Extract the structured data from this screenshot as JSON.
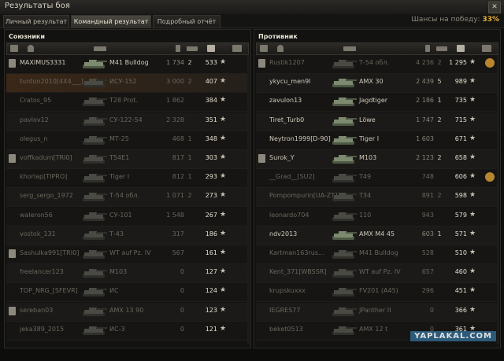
{
  "window": {
    "title": "Результаты боя",
    "close_label": "✕"
  },
  "tabs": [
    {
      "label": "Личный результат",
      "active": false
    },
    {
      "label": "Командный результат",
      "active": true
    },
    {
      "label": "Подробный отчёт",
      "active": false
    }
  ],
  "win_chance": {
    "label": "Шансы на победу:",
    "value": "33%"
  },
  "allies": {
    "title": "Союзники",
    "rows": [
      {
        "platoon": true,
        "name": "MAXIMUS3331",
        "vehicle": "M41 Bulldog",
        "damage": "1 734",
        "frags": "2",
        "xp": "533",
        "alive": true,
        "me": false,
        "medal": false
      },
      {
        "platoon": false,
        "name": "tuntun2010[4X4___]",
        "vehicle": "ИСУ-152",
        "damage": "3 000",
        "frags": "2",
        "xp": "407",
        "alive": false,
        "me": true,
        "medal": false
      },
      {
        "platoon": false,
        "name": "Cratos_95",
        "vehicle": "T28 Prot.",
        "damage": "1 862",
        "frags": "",
        "xp": "384",
        "alive": false,
        "me": false,
        "medal": false
      },
      {
        "platoon": false,
        "name": "pavlov12",
        "vehicle": "СУ-122-54",
        "damage": "2 328",
        "frags": "",
        "xp": "351",
        "alive": false,
        "me": false,
        "medal": false
      },
      {
        "platoon": false,
        "name": "olegus_n",
        "vehicle": "МТ-25",
        "damage": "468",
        "frags": "1",
        "xp": "348",
        "alive": false,
        "me": false,
        "medal": false
      },
      {
        "platoon": true,
        "name": "voffkadum[TRI0]",
        "vehicle": "T54E1",
        "damage": "817",
        "frags": "1",
        "xp": "303",
        "alive": false,
        "me": false,
        "medal": false
      },
      {
        "platoon": false,
        "name": "khorlap[TIPRO]",
        "vehicle": "Tiger I",
        "damage": "812",
        "frags": "1",
        "xp": "293",
        "alive": false,
        "me": false,
        "medal": false
      },
      {
        "platoon": false,
        "name": "serg_sergo_1972",
        "vehicle": "Т-54 обл.",
        "damage": "1 071",
        "frags": "2",
        "xp": "273",
        "alive": false,
        "me": false,
        "medal": false
      },
      {
        "platoon": false,
        "name": "waleron56",
        "vehicle": "СУ-101",
        "damage": "1 548",
        "frags": "",
        "xp": "267",
        "alive": false,
        "me": false,
        "medal": false
      },
      {
        "platoon": false,
        "name": "vostok_131",
        "vehicle": "Т-43",
        "damage": "317",
        "frags": "",
        "xp": "186",
        "alive": false,
        "me": false,
        "medal": false
      },
      {
        "platoon": true,
        "name": "Sashulka991[TRI0]",
        "vehicle": "WT auf Pz. IV",
        "damage": "567",
        "frags": "",
        "xp": "161",
        "alive": false,
        "me": false,
        "medal": false
      },
      {
        "platoon": false,
        "name": "freelancer123",
        "vehicle": "M103",
        "damage": "0",
        "frags": "",
        "xp": "127",
        "alive": false,
        "me": false,
        "medal": false
      },
      {
        "platoon": false,
        "name": "TOP_NRG_[SFEVR]",
        "vehicle": "ИС",
        "damage": "0",
        "frags": "",
        "xp": "124",
        "alive": false,
        "me": false,
        "medal": false
      },
      {
        "platoon": true,
        "name": "sereban03",
        "vehicle": "AMX 13 90",
        "damage": "0",
        "frags": "",
        "xp": "123",
        "alive": false,
        "me": false,
        "medal": false
      },
      {
        "platoon": false,
        "name": "jeka389_2015",
        "vehicle": "ИС-3",
        "damage": "0",
        "frags": "",
        "xp": "121",
        "alive": false,
        "me": false,
        "medal": false
      }
    ]
  },
  "enemies": {
    "title": "Противник",
    "rows": [
      {
        "platoon": true,
        "name": "Rustik1207",
        "vehicle": "Т-54 обл.",
        "damage": "4 236",
        "frags": "2",
        "xp": "1 295",
        "alive": false,
        "me": false,
        "medal": true
      },
      {
        "platoon": false,
        "name": "ykycu_men9l",
        "vehicle": "AMX 30",
        "damage": "2 439",
        "frags": "5",
        "xp": "989",
        "alive": true,
        "me": false,
        "medal": false
      },
      {
        "platoon": false,
        "name": "zavulon13",
        "vehicle": "Jagdtiger",
        "damage": "2 186",
        "frags": "1",
        "xp": "735",
        "alive": true,
        "me": false,
        "medal": false
      },
      {
        "platoon": false,
        "name": "Tiret_Turb0",
        "vehicle": "Löwe",
        "damage": "1 747",
        "frags": "2",
        "xp": "715",
        "alive": true,
        "me": false,
        "medal": false
      },
      {
        "platoon": false,
        "name": "Neytron1999[D-90]",
        "vehicle": "Tiger I",
        "damage": "1 603",
        "frags": "",
        "xp": "671",
        "alive": true,
        "me": false,
        "medal": false
      },
      {
        "platoon": true,
        "name": "Surok_Y",
        "vehicle": "M103",
        "damage": "2 123",
        "frags": "2",
        "xp": "658",
        "alive": true,
        "me": false,
        "medal": false
      },
      {
        "platoon": false,
        "name": "__Grad__[SU2]",
        "vehicle": "T49",
        "damage": "748",
        "frags": "",
        "xp": "606",
        "alive": false,
        "me": false,
        "medal": true
      },
      {
        "platoon": false,
        "name": "Pompompurin[UA-ZT]",
        "vehicle": "T34",
        "damage": "891",
        "frags": "2",
        "xp": "598",
        "alive": false,
        "me": false,
        "medal": false
      },
      {
        "platoon": false,
        "name": "leonardo704",
        "vehicle": "110",
        "damage": "943",
        "frags": "",
        "xp": "579",
        "alive": false,
        "me": false,
        "medal": false
      },
      {
        "platoon": false,
        "name": "ndv2013",
        "vehicle": "AMX M4 45",
        "damage": "603",
        "frags": "1",
        "xp": "571",
        "alive": true,
        "me": false,
        "medal": false
      },
      {
        "platoon": false,
        "name": "Kartman163rus...",
        "vehicle": "M41 Bulldog",
        "damage": "528",
        "frags": "",
        "xp": "510",
        "alive": false,
        "me": false,
        "medal": false
      },
      {
        "platoon": false,
        "name": "Kent_371[WBSSR]",
        "vehicle": "WT auf Pz. IV",
        "damage": "657",
        "frags": "",
        "xp": "460",
        "alive": false,
        "me": false,
        "medal": false
      },
      {
        "platoon": false,
        "name": "krupskuxxx",
        "vehicle": "FV201 (A45)",
        "damage": "296",
        "frags": "",
        "xp": "451",
        "alive": false,
        "me": false,
        "medal": false
      },
      {
        "platoon": false,
        "name": "IEGRES77",
        "vehicle": "JPanther II",
        "damage": "0",
        "frags": "",
        "xp": "366",
        "alive": false,
        "me": false,
        "medal": false
      },
      {
        "platoon": false,
        "name": "beket0513",
        "vehicle": "AMX 12 t",
        "damage": "0",
        "frags": "",
        "xp": "361",
        "alive": false,
        "me": false,
        "medal": false
      }
    ]
  },
  "watermark": "YAPLAKAL.COM",
  "icons": {
    "star": "★",
    "header_icons": [
      "platoon-icon",
      "player-icon",
      "vehicle-icon",
      "damage-icon",
      "frags-icon",
      "xp-icon",
      "medal-icon"
    ]
  }
}
